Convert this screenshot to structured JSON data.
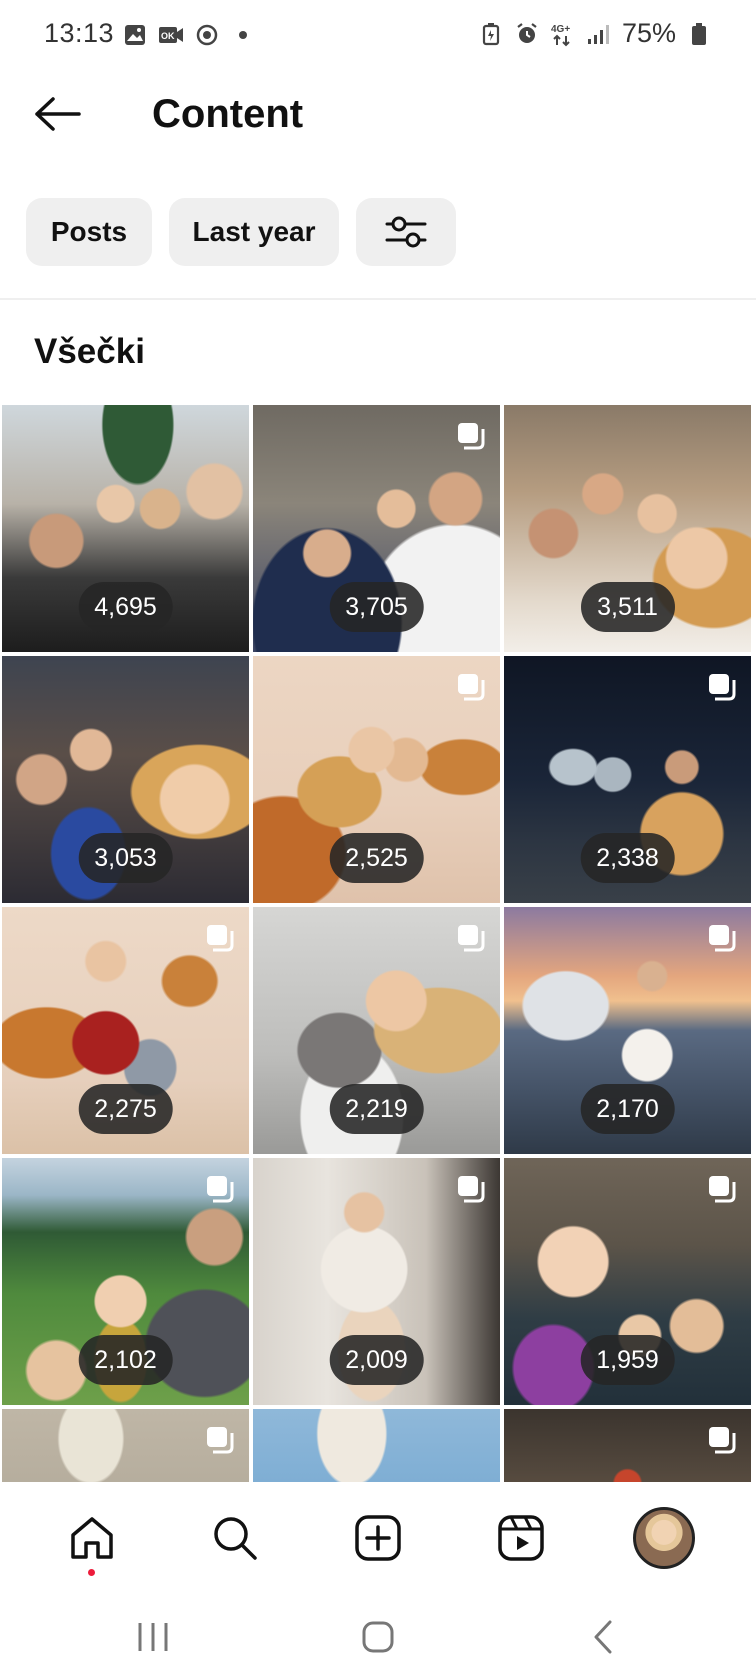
{
  "status_bar": {
    "time": "13:13",
    "battery_percent": "75%",
    "network": "4G+"
  },
  "header": {
    "title": "Content",
    "back_icon": "arrow-left-icon"
  },
  "filters": {
    "type_label": "Posts",
    "period_label": "Last year",
    "settings_icon": "sliders-icon"
  },
  "section": {
    "title": "Všečki"
  },
  "grid": {
    "tiles": [
      {
        "count": "4,695",
        "multi": false
      },
      {
        "count": "3,705",
        "multi": true
      },
      {
        "count": "3,511",
        "multi": false
      },
      {
        "count": "3,053",
        "multi": false
      },
      {
        "count": "2,525",
        "multi": true
      },
      {
        "count": "2,338",
        "multi": true
      },
      {
        "count": "2,275",
        "multi": true
      },
      {
        "count": "2,219",
        "multi": true
      },
      {
        "count": "2,170",
        "multi": true
      },
      {
        "count": "2,102",
        "multi": true
      },
      {
        "count": "2,009",
        "multi": true
      },
      {
        "count": "1,959",
        "multi": true
      },
      {
        "count": "",
        "multi": true
      },
      {
        "count": "",
        "multi": false
      },
      {
        "count": "",
        "multi": true
      }
    ]
  },
  "bottom_nav": {
    "items": [
      "home-icon",
      "search-icon",
      "create-icon",
      "reels-icon",
      "profile-avatar"
    ]
  },
  "system_nav": {
    "items": [
      "recent-apps-icon",
      "home-button-icon",
      "back-icon"
    ]
  },
  "colors": {
    "chip_bg": "#efefef",
    "badge_bg": "#262626",
    "notification_dot": "#ed1c3b"
  }
}
